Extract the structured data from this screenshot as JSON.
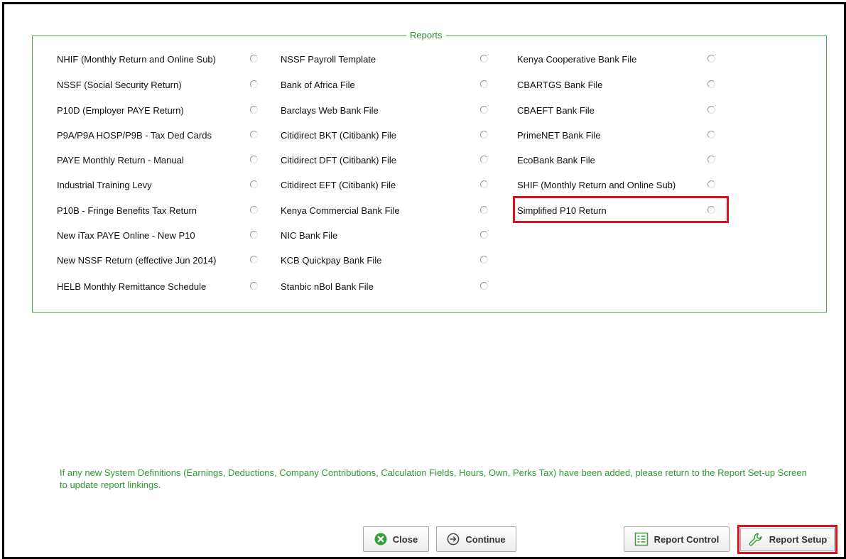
{
  "fieldset": {
    "legend": "Reports"
  },
  "columns": [
    [
      {
        "label": "NHIF (Monthly Return and Online Sub)"
      },
      {
        "label": "NSSF (Social Security Return)"
      },
      {
        "label": "P10D (Employer PAYE Return)"
      },
      {
        "label": "P9A/P9A HOSP/P9B - Tax Ded Cards"
      },
      {
        "label": "PAYE Monthly Return - Manual"
      },
      {
        "label": "Industrial Training Levy"
      },
      {
        "label": "P10B - Fringe Benefits Tax Return"
      },
      {
        "label": "New iTax PAYE Online - New P10"
      },
      {
        "label": "New NSSF Return (effective Jun 2014)"
      },
      {
        "label": "HELB Monthly Remittance Schedule"
      }
    ],
    [
      {
        "label": "NSSF Payroll Template"
      },
      {
        "label": "Bank of Africa File"
      },
      {
        "label": "Barclays Web Bank File"
      },
      {
        "label": "Citidirect BKT (Citibank) File"
      },
      {
        "label": "Citidirect DFT (Citibank) File"
      },
      {
        "label": "Citidirect EFT (Citibank) File"
      },
      {
        "label": "Kenya Commercial Bank File"
      },
      {
        "label": "NIC Bank File"
      },
      {
        "label": "KCB Quickpay Bank File"
      },
      {
        "label": "Stanbic nBol Bank File"
      }
    ],
    [
      {
        "label": "Kenya Cooperative Bank File"
      },
      {
        "label": "CBARTGS Bank File"
      },
      {
        "label": "CBAEFT Bank File"
      },
      {
        "label": "PrimeNET Bank File"
      },
      {
        "label": "EcoBank Bank File"
      },
      {
        "label": "SHIF (Monthly Return and Online Sub)"
      },
      {
        "label": "Simplified P10 Return",
        "highlighted": true
      }
    ]
  ],
  "notice": "If any new System Definitions (Earnings, Deductions, Company Contributions, Calculation Fields, Hours, Own, Perks Tax) have been added, please return to the Report Set-up Screen to update report linkings.",
  "buttons": {
    "close": "Close",
    "continue": "Continue",
    "report_control": "Report Control",
    "report_setup": "Report Setup"
  },
  "colors": {
    "accent_green": "#4aa64a",
    "highlight_red": "#d8121d",
    "notice_green": "#2f9a2f"
  }
}
